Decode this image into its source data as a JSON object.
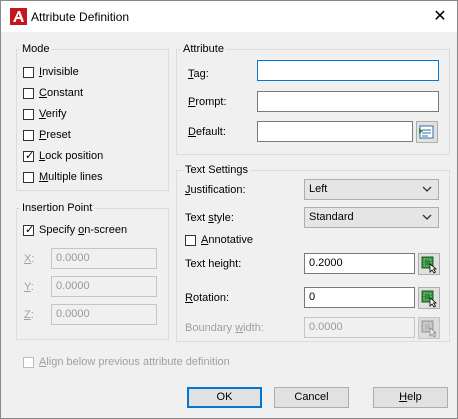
{
  "window": {
    "title": "Attribute Definition",
    "close_glyph": "✕"
  },
  "mode": {
    "legend": "Mode",
    "options": [
      {
        "pre": "",
        "key": "I",
        "post": "nvisible",
        "checked": false
      },
      {
        "pre": "",
        "key": "C",
        "post": "onstant",
        "checked": false
      },
      {
        "pre": "",
        "key": "V",
        "post": "erify",
        "checked": false
      },
      {
        "pre": "",
        "key": "P",
        "post": "reset",
        "checked": false
      },
      {
        "pre": "",
        "key": "L",
        "post": "ock position",
        "checked": true
      },
      {
        "pre": "",
        "key": "M",
        "post": "ultiple lines",
        "checked": false
      }
    ]
  },
  "insertion_point": {
    "legend": "Insertion Point",
    "specify": {
      "pre": "Specify ",
      "key": "o",
      "post": "n-screen",
      "checked": true
    },
    "x": {
      "key": "X",
      "post": ":",
      "value": "0.0000"
    },
    "y": {
      "key": "Y",
      "post": ":",
      "value": "0.0000"
    },
    "z": {
      "key": "Z",
      "post": ":",
      "value": "0.0000"
    }
  },
  "attribute": {
    "legend": "Attribute",
    "tag": {
      "key": "T",
      "post": "ag:",
      "value": ""
    },
    "prompt": {
      "key": "P",
      "post": "rompt:",
      "value": ""
    },
    "default": {
      "pre": "",
      "key": "D",
      "post": "efault:",
      "value": ""
    }
  },
  "text_settings": {
    "legend": "Text Settings",
    "justification": {
      "key": "J",
      "post": "ustification:",
      "value": "Left"
    },
    "text_style": {
      "pre": "Text ",
      "key": "s",
      "post": "tyle:",
      "value": "Standard"
    },
    "annotative": {
      "key": "A",
      "post": "nnotative",
      "checked": false
    },
    "text_height": {
      "pre": "Text hei",
      "key": "g",
      "post": "ht:",
      "value": "0.2000"
    },
    "rotation": {
      "key": "R",
      "post": "otation:",
      "value": "0"
    },
    "boundary_width": {
      "pre": "Boundary ",
      "key": "w",
      "post": "idth:",
      "value": "0.0000"
    }
  },
  "align_below": {
    "key": "A",
    "post": "lign below previous attribute definition",
    "checked": false
  },
  "buttons": {
    "ok": "OK",
    "cancel": "Cancel",
    "help_key": "H",
    "help_post": "elp"
  },
  "colors": {
    "accent": "#0078d7",
    "brand": "#c4161c",
    "pick_green": "#2f8a3b"
  }
}
